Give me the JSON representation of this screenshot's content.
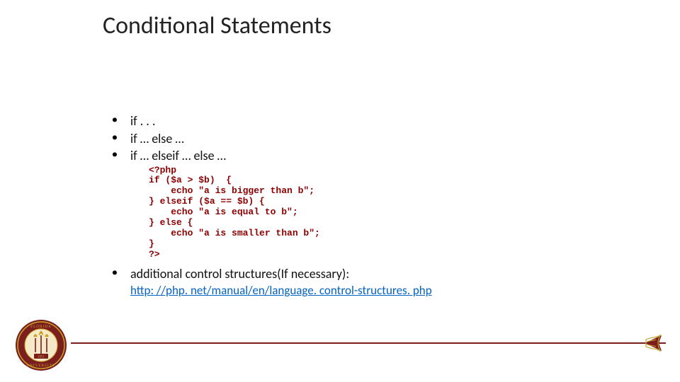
{
  "title": "Conditional Statements",
  "bullets": {
    "b1": "if . . .",
    "b2": "if … else …",
    "b3": "if … elseif … else …",
    "b4": "additional control structures(If necessary):"
  },
  "code": "<?php\nif ($a > $b)  {\n    echo \"a is bigger than b\";\n} elseif ($a == $b) {\n    echo \"a is equal to b\";\n} else {\n    echo \"a is smaller than b\";\n}\n?>",
  "link_text": "http: //php. net/manual/en/language. control-structures. php",
  "colors": {
    "garnet": "#7a1e1e",
    "gold": "#c9a227",
    "link": "#0563c1",
    "code": "#8b0000"
  }
}
